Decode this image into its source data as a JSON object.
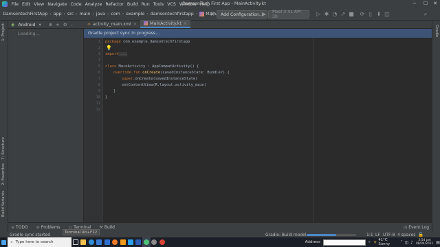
{
  "menu": {
    "items": [
      "File",
      "Edit",
      "View",
      "Navigate",
      "Code",
      "Analyze",
      "Refactor",
      "Build",
      "Run",
      "Tools",
      "VCS",
      "Window",
      "Help"
    ],
    "window_title": "DamsonTech First App - MainActivity.kt"
  },
  "nav": {
    "breadcrumbs": [
      "DamsontechFirstApp",
      "app",
      "src",
      "main",
      "java",
      "com",
      "example",
      "damsontechfirstapp",
      "MainActivity"
    ],
    "add_config": "Add Configuration...",
    "device": "Pixel 3 XL API 30"
  },
  "project_panel": {
    "view": "Android",
    "loading": "Loading..."
  },
  "side_tabs": {
    "project": "1: Project",
    "structure": "7: Structure",
    "favorites": "2: Favorites",
    "build_variants": "Build Variants",
    "gradle": "Gradle"
  },
  "tabs": [
    {
      "label": "activity_main.xml",
      "active": false
    },
    {
      "label": "MainActivity.kt",
      "active": true
    }
  ],
  "banner": "Gradle project sync in progress...",
  "code": {
    "line_numbers": [
      "1",
      "2",
      "3",
      "4",
      "5",
      "6",
      "7",
      "8",
      "9",
      "10",
      "11",
      "12"
    ],
    "l1_kw": "package",
    "l1_rest": " com.example.damsontechfirstapp",
    "l3_kw": "import",
    "l3_rest": " ...",
    "l5_kw": "class",
    "l5_rest": " MainActivity : AppCompatActivity() {",
    "l6_kw": "override fun",
    "l6_fn": " onCreate",
    "l6_rest": "(savedInstanceState: Bundle?) {",
    "l7_kw": "super",
    "l7_rest": ".onCreate(savedInstanceState)",
    "l8": "setContentView(R.layout.activity_main)",
    "l9": "}",
    "l10": "}"
  },
  "bottom_tabs": {
    "todo": "TODO",
    "problems": "Problems",
    "terminal": "Terminal",
    "build": "Build",
    "event_log": "Event Log"
  },
  "tooltip": "Terminal  Alt+F12",
  "status": {
    "left": "Gradle sync started",
    "process": "Gradle: Build model...",
    "position": "1:1",
    "line_sep": "LF",
    "encoding": "UTF-8",
    "indent": "4 spaces"
  },
  "taskbar": {
    "search_placeholder": "Type here to search",
    "address_label": "Address",
    "weather": "41°C  Sunny",
    "time": "2:54 pm",
    "date": "08/04/2021"
  },
  "colors": {
    "accent": "#4a88c7",
    "banner": "#3d5476",
    "keyword": "#cc7832",
    "function": "#ffc66d"
  }
}
